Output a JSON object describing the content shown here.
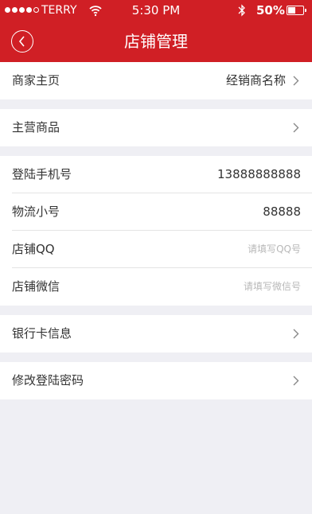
{
  "status_bar": {
    "carrier": "TERRY",
    "time": "5:30 PM",
    "battery_percent": "50%",
    "battery_level": 0.5
  },
  "header": {
    "title": "店铺管理"
  },
  "rows": {
    "merchant_home": {
      "label": "商家主页",
      "value": "经销商名称"
    },
    "main_products": {
      "label": "主营商品"
    },
    "login_phone": {
      "label": "登陆手机号",
      "value": "13888888888"
    },
    "logistics_number": {
      "label": "物流小号",
      "value": "88888"
    },
    "store_qq": {
      "label": "店铺QQ",
      "placeholder": "请填写QQ号"
    },
    "store_wechat": {
      "label": "店铺微信",
      "placeholder": "请填写微信号"
    },
    "bank_card": {
      "label": "银行卡信息"
    },
    "change_password": {
      "label": "修改登陆密码"
    }
  },
  "colors": {
    "header_bg": "#d01f25",
    "page_bg": "#efeff4"
  }
}
